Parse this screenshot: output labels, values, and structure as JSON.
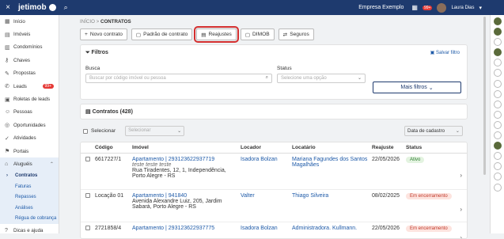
{
  "topbar": {
    "close": "×",
    "logo": "jetimob",
    "company": "Empresa Exemplo",
    "notif_count": "99+",
    "user": "Laura Dias"
  },
  "sidebar": {
    "items": [
      {
        "icon": "▦",
        "label": "Início"
      },
      {
        "icon": "▤",
        "label": "Imóveis"
      },
      {
        "icon": "▥",
        "label": "Condomínios"
      },
      {
        "icon": "⚷",
        "label": "Chaves"
      },
      {
        "icon": "✎",
        "label": "Propostas"
      },
      {
        "icon": "✆",
        "label": "Leads",
        "badge": "99+"
      },
      {
        "icon": "▣",
        "label": "Roletas de leads"
      },
      {
        "icon": "☺",
        "label": "Pessoas"
      },
      {
        "icon": "◎",
        "label": "Oportunidades"
      },
      {
        "icon": "✓",
        "label": "Atividades"
      },
      {
        "icon": "⚑",
        "label": "Portais"
      },
      {
        "icon": "⌂",
        "label": "Aluguéis"
      }
    ],
    "sub": [
      "Contratos",
      "Faturas",
      "Repasses",
      "Análises",
      "Régua de cobrança"
    ],
    "footer": {
      "icon": "?",
      "label": "Dicas e ajuda"
    }
  },
  "breadcrumb": {
    "home": "INÍCIO",
    "sep": " > ",
    "current": "CONTRATOS"
  },
  "toolbar": [
    {
      "icon": "+",
      "label": "Novo contrato"
    },
    {
      "icon": "▢",
      "label": "Padrão de contrato"
    },
    {
      "icon": "▤",
      "label": "Reajustes"
    },
    {
      "icon": "▢",
      "label": "DIMOB"
    },
    {
      "icon": "⇄",
      "label": "Seguros"
    }
  ],
  "filters": {
    "title": "Filtros",
    "clear": "Salvar filtro",
    "busca_label": "Busca",
    "busca_placeholder": "Buscar por código imóvel ou pessoa",
    "status_label": "Status",
    "status_placeholder": "Selecione uma opção",
    "more": "Mais filtros"
  },
  "contracts_title": "Contratos (428)",
  "select": {
    "label": "Selecionar",
    "placeholder": "Selecionar",
    "sort": "Data de cadastro"
  },
  "table": {
    "headers": [
      "Código",
      "Imóvel",
      "Locador",
      "Locatário",
      "Reajuste",
      "Status"
    ],
    "rows": [
      {
        "code": "6617227/1",
        "property": "Apartamento | 293123622937719",
        "sub": "teste teste teste",
        "address": "Rua Tiradentes, 12, 1, Independência, Porto Alegre - RS",
        "locador": "Isadora Bolzan",
        "locatario": "Mariana Fagundes dos Santos Magalhães",
        "reajuste": "22/05/2026",
        "status": "Ativo",
        "status_bg": "#e3f3e0",
        "status_fg": "#2e7d32"
      },
      {
        "code": "Locação 01",
        "property": "Apartamento | 941840",
        "sub": "",
        "address": "Avenida Alexandre Luiz, 205, Jardim Sabará, Porto Alegre - RS",
        "locador": "Valter",
        "locatario": "Thiago Silveira",
        "reajuste": "08/02/2025",
        "status": "Em encerramento",
        "status_bg": "#fde4df",
        "status_fg": "#c0392b"
      },
      {
        "code": "2721858/4",
        "property": "Apartamento | 293123622937775",
        "sub": "",
        "address": "",
        "locador": "Isadora Bolzan",
        "locatario": "Administradora. Kullmann.",
        "reajuste": "22/05/2026",
        "status": "Em encerramento",
        "status_bg": "#fde4df",
        "status_fg": "#c0392b"
      }
    ]
  },
  "right_rail": [
    "green",
    "green",
    "grey",
    "green",
    "grey",
    "grey",
    "grey",
    "grey",
    "grey",
    "grey",
    "grey",
    "grey",
    "green",
    "grey",
    "grey",
    "grey",
    "grey"
  ]
}
